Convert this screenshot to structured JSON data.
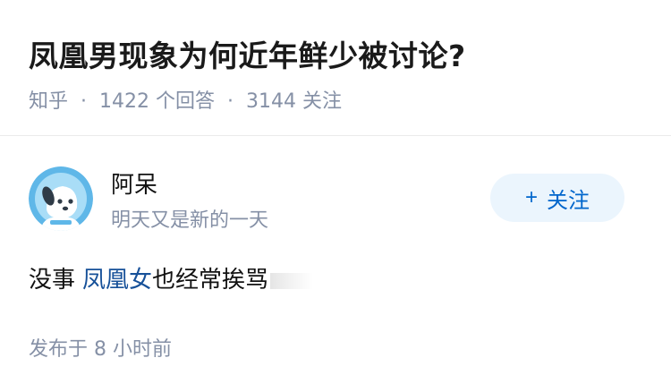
{
  "question": {
    "title": "凤凰男现象为何近年鲜少被讨论?",
    "source": "知乎",
    "answers_count": "1422",
    "answers_label": "个回答",
    "followers_count": "3144",
    "followers_label": "关注",
    "separator": "·"
  },
  "author": {
    "avatar_icon": "dog-mascot-icon",
    "name": "阿呆",
    "bio": "明天又是新的一天",
    "follow_label": "关注",
    "follow_icon": "+"
  },
  "answer": {
    "text_before": "没事",
    "link_text": "凤凰女",
    "text_after": "也经常挨骂"
  },
  "footer": {
    "published_label": "发布于",
    "time_ago": "8 小时前"
  },
  "colors": {
    "accent": "#0066cc",
    "muted": "#8590a6",
    "link": "#175199",
    "follow_bg": "#ebf5fd"
  }
}
